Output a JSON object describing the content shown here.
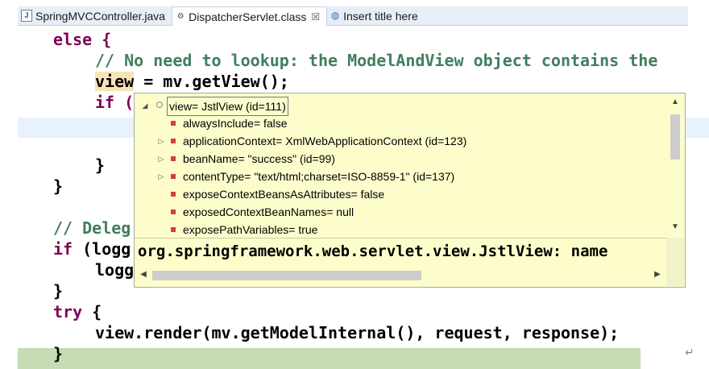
{
  "tabs": [
    {
      "label": "SpringMVCController.java",
      "icon": "java-file-icon",
      "active": false
    },
    {
      "label": "DispatcherServlet.class",
      "icon": "class-file-icon",
      "active": true,
      "close": "☒"
    },
    {
      "label": "Insert title here",
      "icon": "web-page-icon",
      "active": false
    }
  ],
  "code": {
    "l1": "else {",
    "l2": "// No need to lookup: the ModelAndView object contains the",
    "l3a": "view",
    "l3b": " = mv.getView();",
    "l4": "if (",
    "l5": "}",
    "l6": "}",
    "l7": "// Deleg",
    "l8a": "if",
    "l8b": " (logg",
    "l9": "logg",
    "l10": "}",
    "l11a": "try",
    "l11b": " {",
    "l12": "view.render(mv.getModelInternal(), request, response);",
    "l13": "}"
  },
  "popup": {
    "root": "view= JstlView  (id=111)",
    "fields": [
      {
        "label": "alwaysInclude= false",
        "expandable": false
      },
      {
        "label": "applicationContext= XmlWebApplicationContext  (id=123)",
        "expandable": true
      },
      {
        "label": "beanName= \"success\" (id=99)",
        "expandable": true
      },
      {
        "label": "contentType= \"text/html;charset=ISO-8859-1\" (id=137)",
        "expandable": true
      },
      {
        "label": "exposeContextBeansAsAttributes= false",
        "expandable": false
      },
      {
        "label": "exposedContextBeanNames= null",
        "expandable": false
      },
      {
        "label": "exposePathVariables= true",
        "expandable": false
      }
    ],
    "detail": "org.springframework.web.servlet.view.JstlView: name"
  }
}
